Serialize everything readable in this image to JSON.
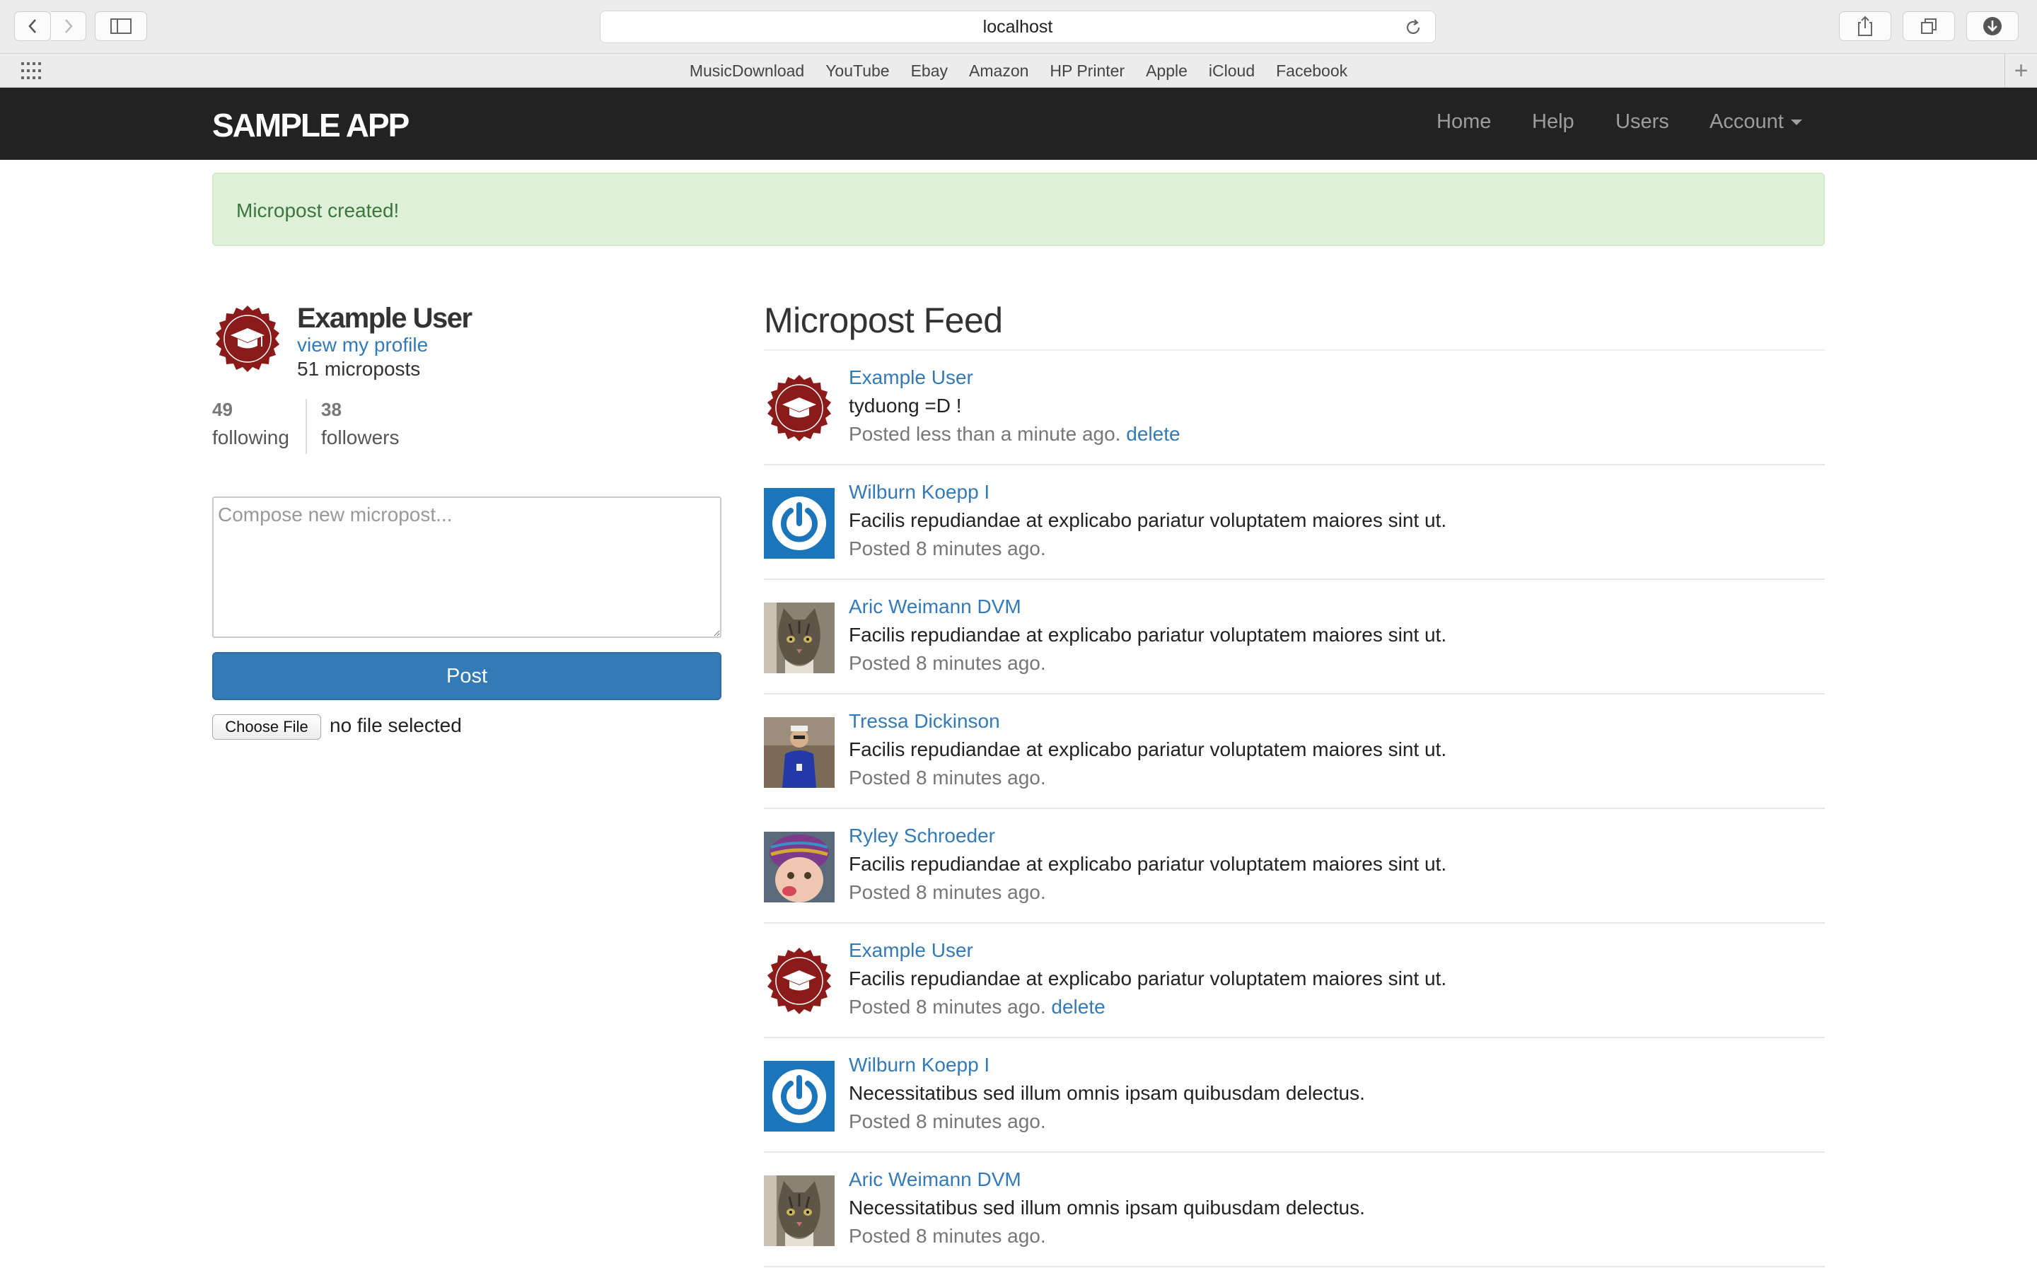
{
  "browser": {
    "url": "localhost",
    "favorites": [
      "MusicDownload",
      "YouTube",
      "Ebay",
      "Amazon",
      "HP Printer",
      "Apple",
      "iCloud",
      "Facebook"
    ]
  },
  "navbar": {
    "logo": "SAMPLE APP",
    "links": {
      "home": "Home",
      "help": "Help",
      "users": "Users",
      "account": "Account"
    }
  },
  "flash": "Micropost created!",
  "sidebar": {
    "name": "Example User",
    "profile_link": "view my profile",
    "micropost_count": "51 microposts",
    "following_count": "49",
    "following_label": "following",
    "followers_count": "38",
    "followers_label": "followers",
    "compose_placeholder": "Compose new micropost...",
    "post_button": "Post",
    "file_button": "Choose File",
    "file_status": "no file selected"
  },
  "feed": {
    "title": "Micropost Feed",
    "items": [
      {
        "user": "Example User",
        "content": "tyduong =D !",
        "timestamp": "Posted less than a minute ago.",
        "delete": "delete",
        "avatar": "badge-icon"
      },
      {
        "user": "Wilburn Koepp I",
        "content": "Facilis repudiandae at explicabo pariatur voluptatem maiores sint ut.",
        "timestamp": "Posted 8 minutes ago.",
        "delete": "",
        "avatar": "power-icon"
      },
      {
        "user": "Aric Weimann DVM",
        "content": "Facilis repudiandae at explicabo pariatur voluptatem maiores sint ut.",
        "timestamp": "Posted 8 minutes ago.",
        "delete": "",
        "avatar": "cat-photo"
      },
      {
        "user": "Tressa Dickinson",
        "content": "Facilis repudiandae at explicabo pariatur voluptatem maiores sint ut.",
        "timestamp": "Posted 8 minutes ago.",
        "delete": "",
        "avatar": "person-photo"
      },
      {
        "user": "Ryley Schroeder",
        "content": "Facilis repudiandae at explicabo pariatur voluptatem maiores sint ut.",
        "timestamp": "Posted 8 minutes ago.",
        "delete": "",
        "avatar": "child-photo"
      },
      {
        "user": "Example User",
        "content": "Facilis repudiandae at explicabo pariatur voluptatem maiores sint ut.",
        "timestamp": "Posted 8 minutes ago.",
        "delete": "delete",
        "avatar": "badge-icon"
      },
      {
        "user": "Wilburn Koepp I",
        "content": "Necessitatibus sed illum omnis ipsam quibusdam delectus.",
        "timestamp": "Posted 8 minutes ago.",
        "delete": "",
        "avatar": "power-icon"
      },
      {
        "user": "Aric Weimann DVM",
        "content": "Necessitatibus sed illum omnis ipsam quibusdam delectus.",
        "timestamp": "Posted 8 minutes ago.",
        "delete": "",
        "avatar": "cat-photo"
      }
    ]
  },
  "colors": {
    "link": "#337ab7",
    "navbar": "#222222",
    "flash_bg": "#dff0d8",
    "flash_text": "#3c763d",
    "badge": "#8b1a1a"
  }
}
